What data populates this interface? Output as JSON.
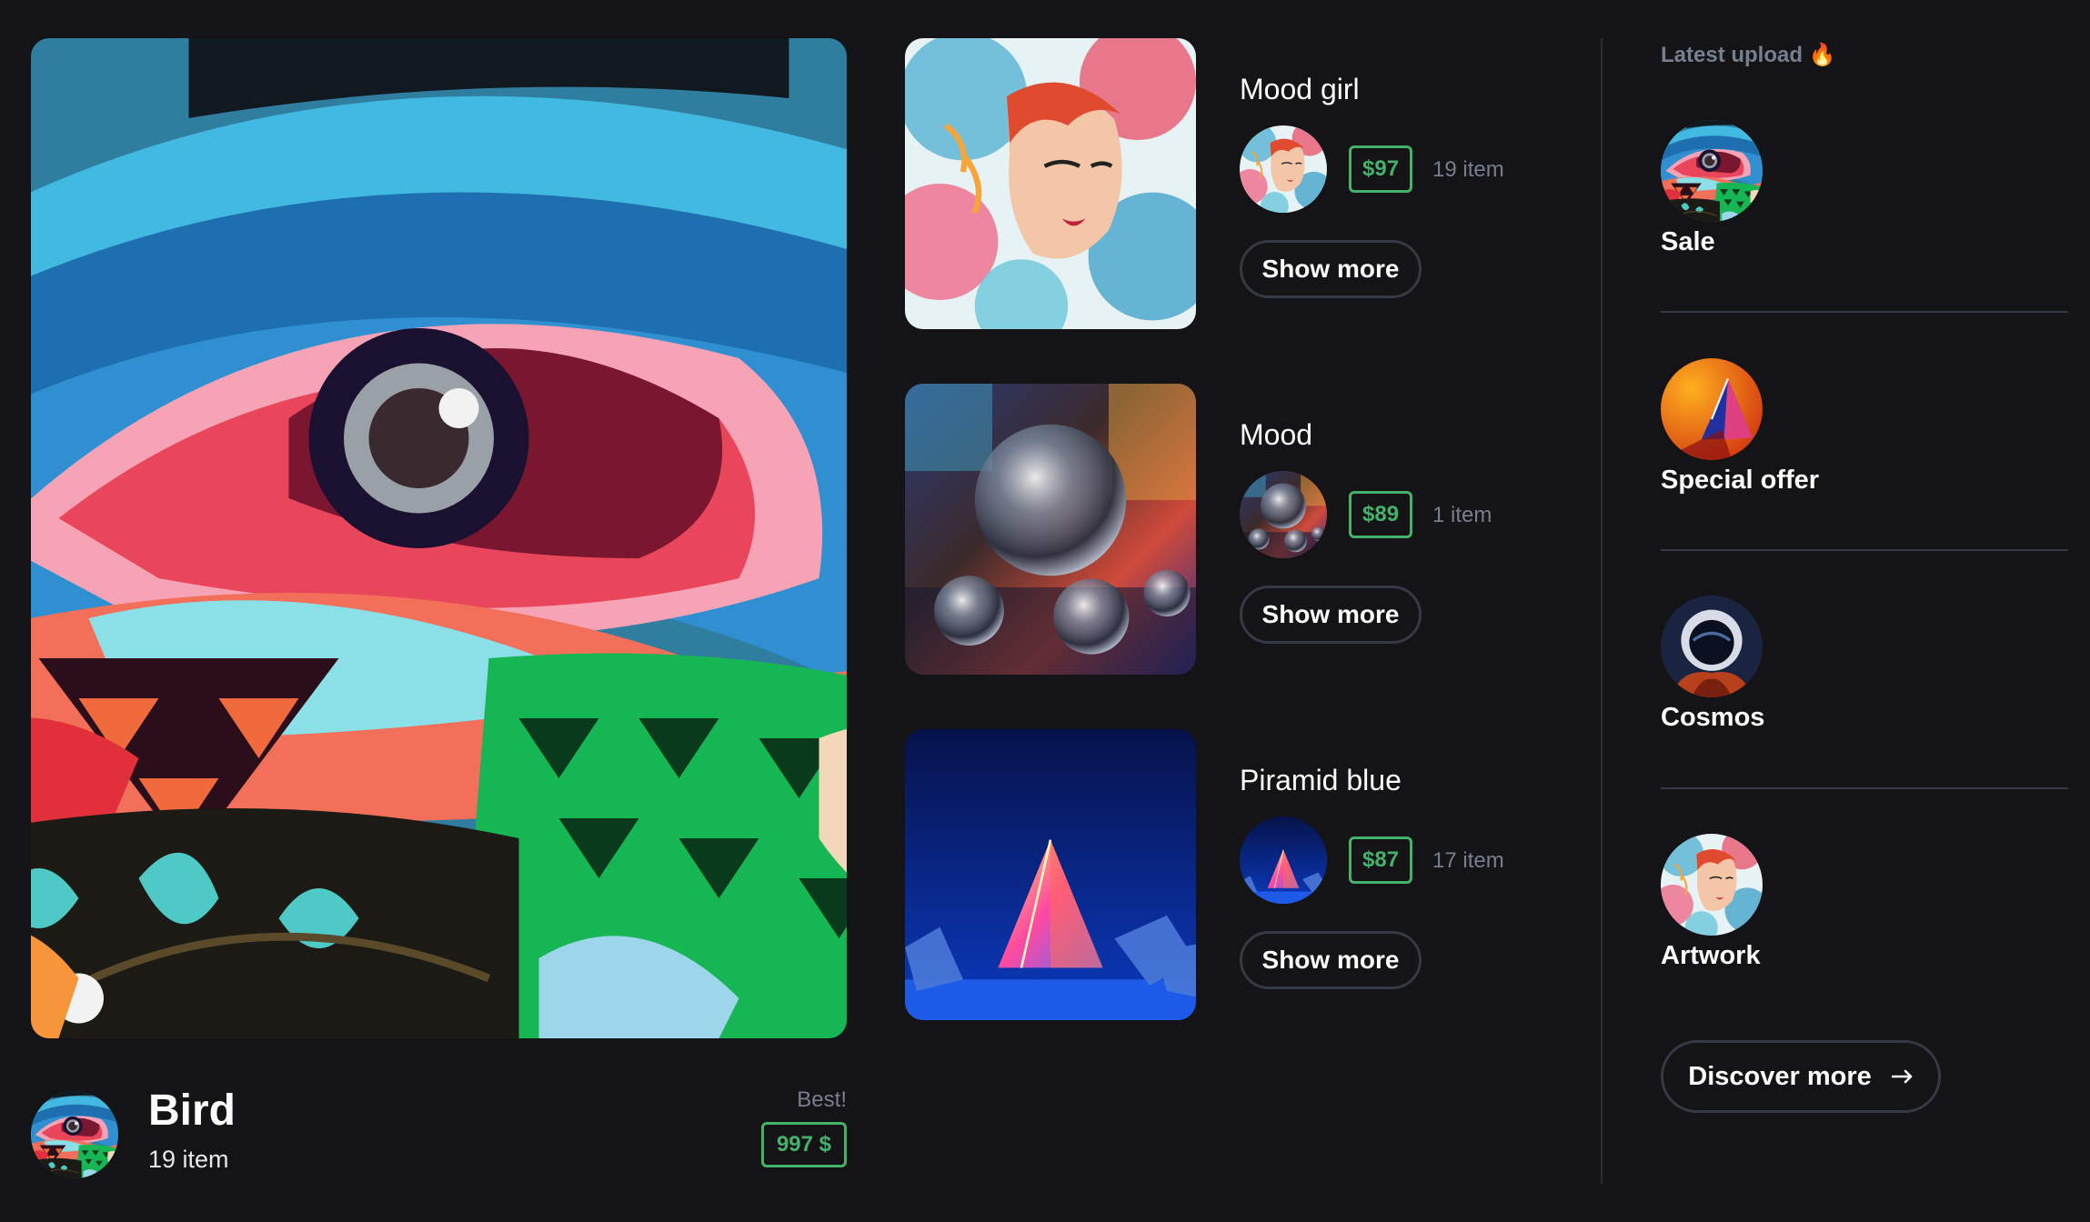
{
  "featured": {
    "title": "Bird",
    "count": "19 item",
    "badge": "Best!",
    "price": "997 $",
    "image": "abstract-bird-painting"
  },
  "items": [
    {
      "title": "Mood girl",
      "price": "$97",
      "count": "19 item",
      "button": "Show more",
      "image": "watercolor-girl"
    },
    {
      "title": "Mood",
      "price": "$89",
      "count": "1 item",
      "button": "Show more",
      "image": "glass-sphere"
    },
    {
      "title": "Piramid blue",
      "price": "$87",
      "count": "17 item",
      "button": "Show more",
      "image": "neon-pyramid"
    }
  ],
  "sidebar": {
    "label": "Latest upload 🔥",
    "items": [
      {
        "name": "Sale",
        "image": "bird"
      },
      {
        "name": "Special offer",
        "image": "orange-pyramid"
      },
      {
        "name": "Cosmos",
        "image": "astronaut"
      },
      {
        "name": "Artwork",
        "image": "watercolor-girl"
      }
    ],
    "discover": "Discover more",
    "discover_icon": "arrow-right-icon"
  },
  "colors": {
    "background": "#141416",
    "price_green": "#45B26B",
    "muted_text": "#777E90",
    "border": "#353945"
  }
}
